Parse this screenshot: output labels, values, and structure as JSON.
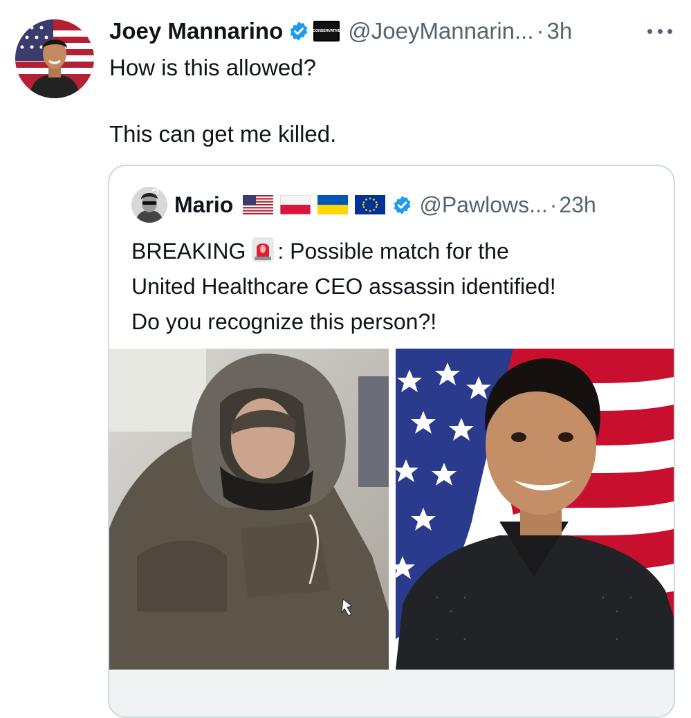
{
  "author": {
    "name": "Joey Mannarino",
    "handle": "@JoeyMannarin...",
    "separator": "·",
    "time": "3h",
    "affiliation_badge": "CONSERVATIVE"
  },
  "tweet": {
    "line1": "How is this allowed?",
    "line2": "This can get me killed."
  },
  "quoted": {
    "name": "Mario",
    "flags": [
      "us-flag",
      "poland-flag",
      "ukraine-flag",
      "eu-flag"
    ],
    "handle": "@Pawlows...",
    "separator": "·",
    "time": "23h",
    "text_lines": {
      "l1_a": "BREAKING",
      "l1_b": ": Possible match for the",
      "l2": "United Healthcare CEO assassin identified!",
      "l3": "Do you recognize this person?!"
    }
  },
  "colors": {
    "verified": "#1d9bf0",
    "secondary_text": "#536471",
    "border": "#cfd9de"
  }
}
